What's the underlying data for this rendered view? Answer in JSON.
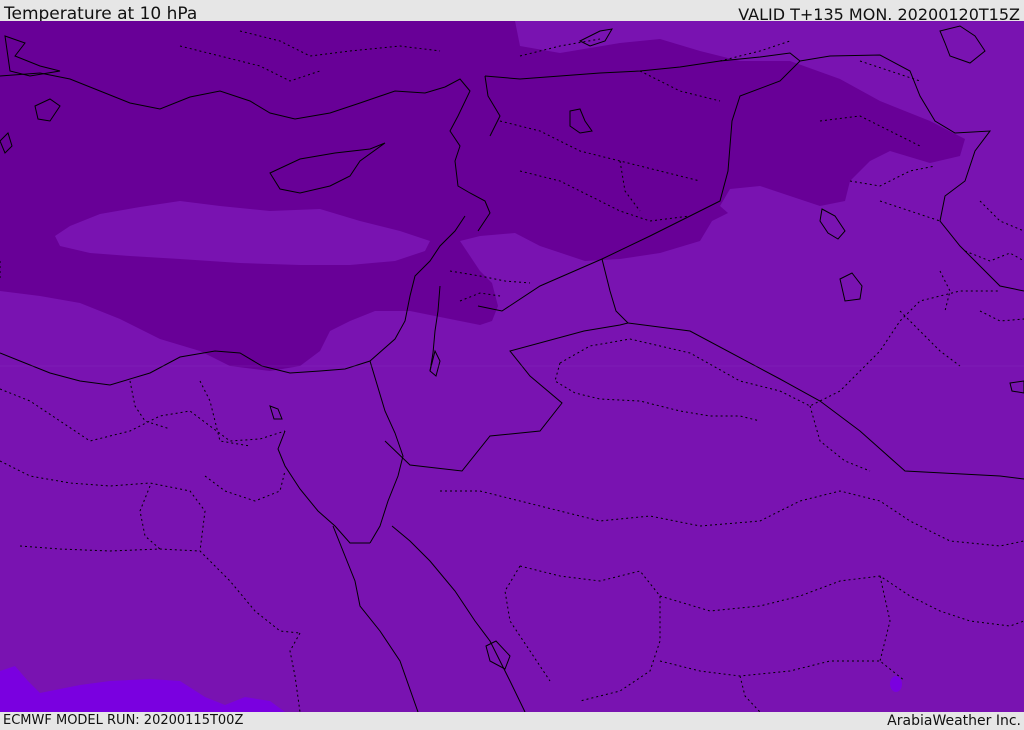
{
  "header": {
    "title": "Temperature at 10 hPa",
    "valid": "VALID T+135 MON. 20200120T15Z"
  },
  "footer": {
    "model_run": "ECMWF MODEL RUN: 20200115T00Z",
    "credit": "ArabiaWeather Inc."
  },
  "colors": {
    "field_base": "#7913b1",
    "field_cold": "#680097",
    "field_lightest": "#7a00e0",
    "borders": "#000000"
  }
}
